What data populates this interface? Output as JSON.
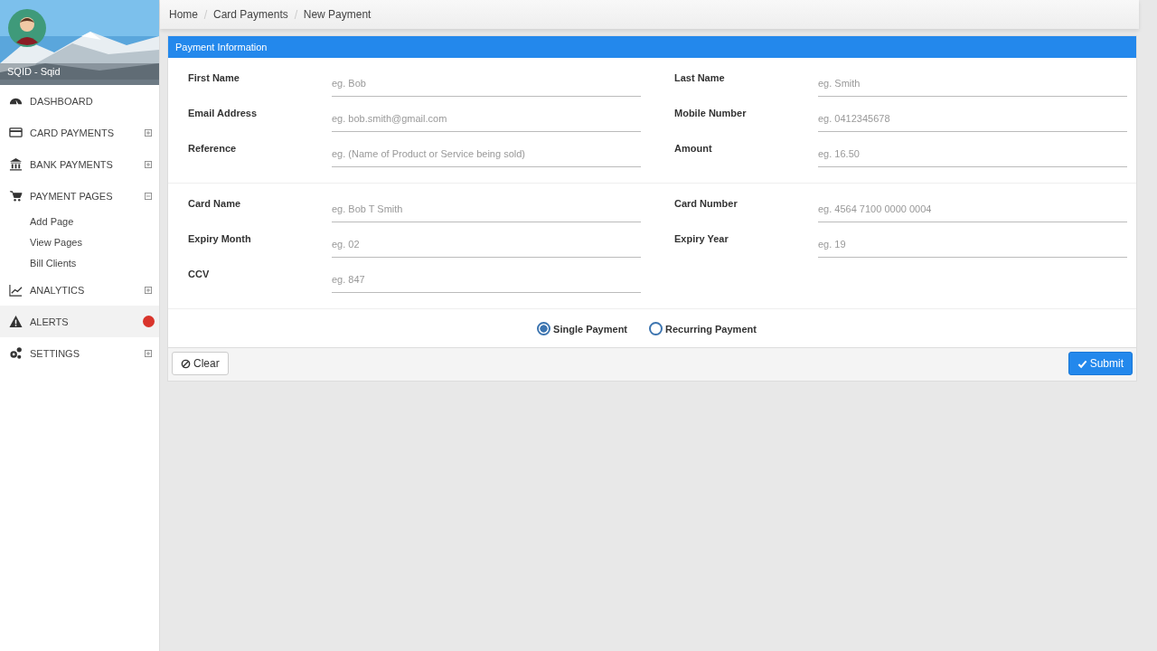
{
  "profile": {
    "name": "SQID - Sqid"
  },
  "sidebar": {
    "items": [
      {
        "label": "DASHBOARD",
        "kind": "dashboard",
        "selected": false
      },
      {
        "label": "CARD PAYMENTS",
        "kind": "card",
        "expanded": false,
        "selected": false
      },
      {
        "label": "BANK PAYMENTS",
        "kind": "bank",
        "expanded": false,
        "selected": false
      },
      {
        "label": "PAYMENT PAGES",
        "kind": "cart",
        "expanded": true,
        "selected": false,
        "children": [
          {
            "label": "Add Page"
          },
          {
            "label": "View Pages"
          },
          {
            "label": "Bill Clients"
          }
        ]
      },
      {
        "label": "ANALYTICS",
        "kind": "chart",
        "expanded": false,
        "selected": false
      },
      {
        "label": "ALERTS",
        "kind": "alert",
        "selected": true,
        "badge": true
      },
      {
        "label": "SETTINGS",
        "kind": "gears",
        "expanded": false,
        "selected": false
      }
    ]
  },
  "breadcrumb": [
    "Home",
    "Card Payments",
    "New Payment"
  ],
  "panel": {
    "title": "Payment Information",
    "sections": [
      [
        {
          "label": "First Name",
          "placeholder": "eg. Bob"
        },
        {
          "label": "Last Name",
          "placeholder": "eg. Smith"
        },
        {
          "label": "Email Address",
          "placeholder": "eg. bob.smith@gmail.com"
        },
        {
          "label": "Mobile Number",
          "placeholder": "eg. 0412345678"
        },
        {
          "label": "Reference",
          "placeholder": "eg. (Name of Product or Service being sold)"
        },
        {
          "label": "Amount",
          "placeholder": "eg. 16.50"
        }
      ],
      [
        {
          "label": "Card Name",
          "placeholder": "eg. Bob T Smith"
        },
        {
          "label": "Card Number",
          "placeholder": "eg. 4564 7100 0000 0004"
        },
        {
          "label": "Expiry Month",
          "placeholder": "eg. 02"
        },
        {
          "label": "Expiry Year",
          "placeholder": "eg. 19"
        },
        {
          "label": "CCV",
          "placeholder": "eg. 847"
        }
      ]
    ],
    "payment_types": [
      {
        "label": "Single Payment",
        "selected": true
      },
      {
        "label": "Recurring Payment",
        "selected": false
      }
    ],
    "buttons": {
      "clear": "Clear",
      "submit": "Submit"
    }
  }
}
